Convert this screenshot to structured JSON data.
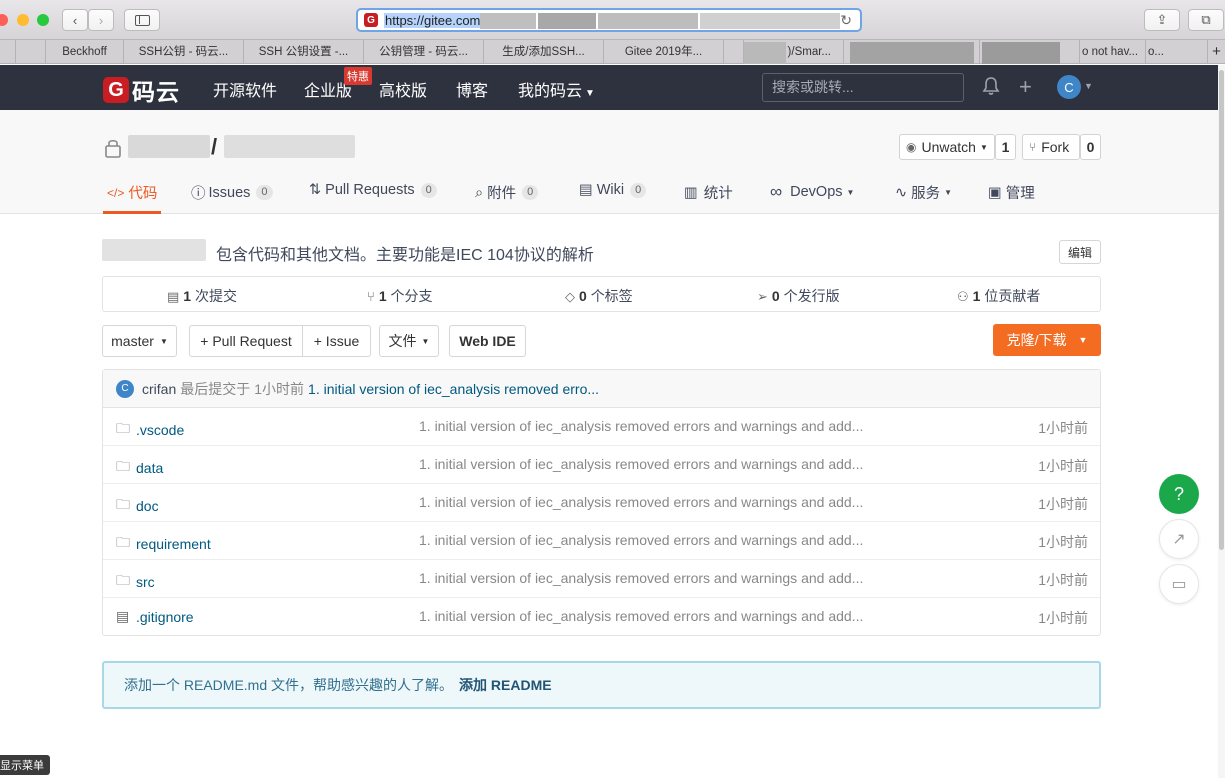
{
  "browser": {
    "url": "https://gitee.com",
    "tabs": [
      "Beckhoff",
      "SSH公钥 - 码云...",
      "SSH 公钥设置 -...",
      "公钥管理 - 码云...",
      "生成/添加SSH...",
      "Gitee 2019年...",
      ")/Smar...",
      "o not hav...",
      "o..."
    ],
    "new_tab_icon": "plus-icon"
  },
  "header": {
    "logo_letter": "G",
    "logo_text": "码云",
    "nav": [
      "开源软件",
      "企业版",
      "高校版",
      "博客",
      "我的码云"
    ],
    "enterprise_badge": "特惠",
    "search_placeholder": "搜索或跳转...",
    "avatar_letter": "C"
  },
  "repo": {
    "separator": "/",
    "watch_label": "Unwatch",
    "watch_count": "1",
    "fork_label": "Fork",
    "fork_count": "0",
    "tabs": [
      {
        "icon": "</>",
        "label": "代码",
        "count": ""
      },
      {
        "icon": "ⓘ",
        "label": "Issues",
        "count": "0"
      },
      {
        "icon": "⇅",
        "label": "Pull Requests",
        "count": "0"
      },
      {
        "icon": "⌕",
        "label": "附件",
        "count": "0"
      },
      {
        "icon": "▤",
        "label": "Wiki",
        "count": "0"
      },
      {
        "icon": "▥",
        "label": "统计",
        "count": ""
      },
      {
        "icon": "∞",
        "label": "DevOps",
        "count": ""
      },
      {
        "icon": "∿",
        "label": "服务",
        "count": ""
      },
      {
        "icon": "▣",
        "label": "管理",
        "count": ""
      }
    ],
    "description": "包含代码和其他文档。主要功能是IEC 104协议的解析",
    "edit_label": "编辑",
    "stats": [
      {
        "num": "1",
        "label": "次提交"
      },
      {
        "num": "1",
        "label": "个分支"
      },
      {
        "num": "0",
        "label": "个标签"
      },
      {
        "num": "0",
        "label": "个发行版"
      },
      {
        "num": "1",
        "label": "位贡献者"
      }
    ],
    "branch": "master",
    "new_pr": "+ Pull Request",
    "new_issue": "+ Issue",
    "file_menu": "文件",
    "web_ide": "Web IDE",
    "clone": "克隆/下载"
  },
  "last_commit": {
    "avatar": "C",
    "user": "crifan",
    "text": "最后提交于",
    "time": "1小时前",
    "message": "1. initial version of iec_analysis removed erro..."
  },
  "files": [
    {
      "type": "folder",
      "name": ".vscode",
      "message": "1. initial version of iec_analysis removed errors and warnings and add...",
      "time": "1小时前"
    },
    {
      "type": "folder",
      "name": "data",
      "message": "1. initial version of iec_analysis removed errors and warnings and add...",
      "time": "1小时前"
    },
    {
      "type": "folder",
      "name": "doc",
      "message": "1. initial version of iec_analysis removed errors and warnings and add...",
      "time": "1小时前"
    },
    {
      "type": "folder",
      "name": "requirement",
      "message": "1. initial version of iec_analysis removed errors and warnings and add...",
      "time": "1小时前"
    },
    {
      "type": "folder",
      "name": "src",
      "message": "1. initial version of iec_analysis removed errors and warnings and add...",
      "time": "1小时前"
    },
    {
      "type": "file",
      "name": ".gitignore",
      "message": "1. initial version of iec_analysis removed errors and warnings and add...",
      "time": "1小时前"
    }
  ],
  "readme_notice": {
    "text": "添加一个 README.md 文件，帮助感兴趣的人了解。",
    "link": "添加 README"
  },
  "float": {
    "help": "?"
  },
  "menu_tip": "显示菜单",
  "colors": {
    "brand": "#c71d23",
    "accent": "#ea5a21",
    "clone": "#f36c21",
    "header": "#2e323e",
    "link": "#005980"
  }
}
